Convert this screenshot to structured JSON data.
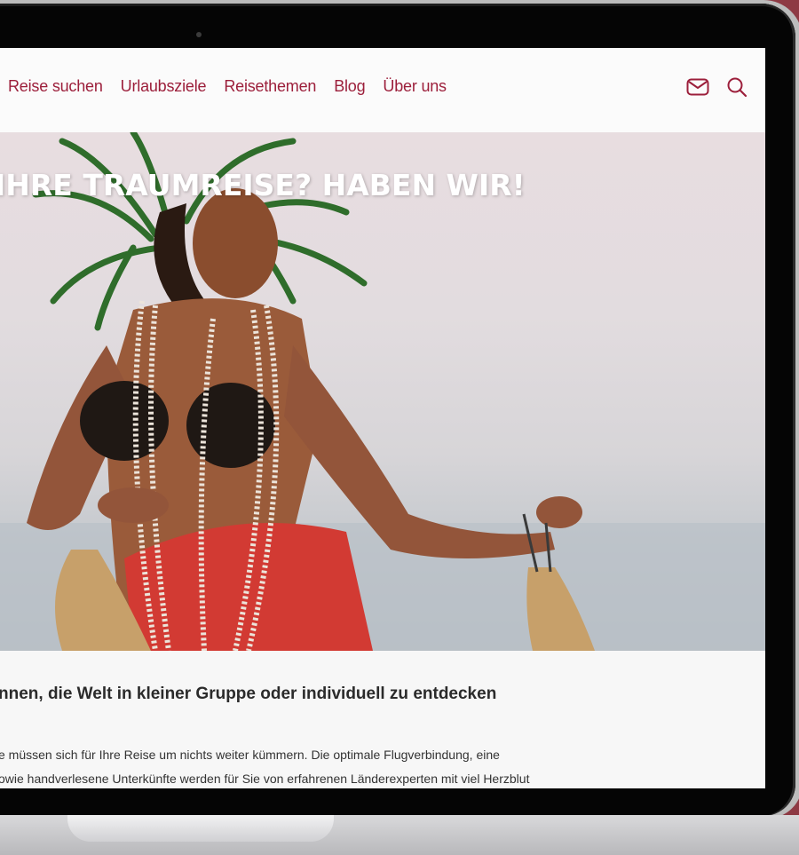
{
  "nav": {
    "items": [
      {
        "label": "Reise suchen"
      },
      {
        "label": "Urlaubsziele"
      },
      {
        "label": "Reisethemen"
      },
      {
        "label": "Blog"
      },
      {
        "label": "Über uns"
      }
    ],
    "icons": [
      "mail-icon",
      "search-icon"
    ]
  },
  "hero": {
    "title": "IHRE TRAUMREISE? HABEN WIR!"
  },
  "content": {
    "headline": "nnen, die Welt in kleiner Gruppe oder individuell zu entdecken",
    "body_lines": [
      "e müssen sich für Ihre Reise um nichts weiter kümmern. Die optimale Flugverbindung, eine",
      "owie handverlesene Unterkünfte werden für Sie von erfahrenen Länderexperten mit viel Herzblut"
    ]
  },
  "colors": {
    "brand": "#9c1f3b",
    "frame": "#8e3a44"
  }
}
